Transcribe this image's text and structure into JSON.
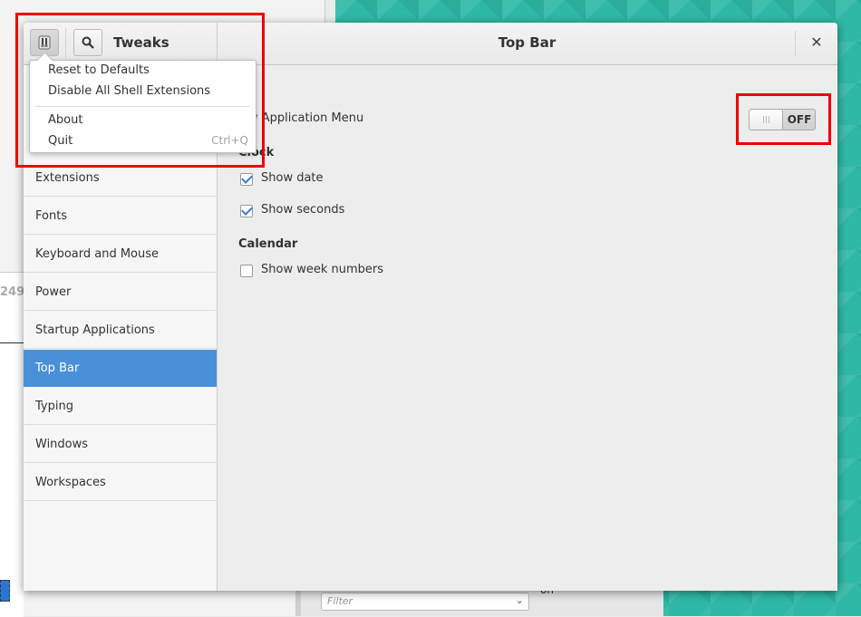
{
  "background": {
    "left_number_fragment": "249",
    "filter_placeholder": "Filter",
    "text_fragment": "on"
  },
  "headerbar": {
    "app_title": "Tweaks",
    "page_title": "Top Bar",
    "close_glyph": "✕"
  },
  "app_menu": {
    "items": [
      {
        "label": "Reset to Defaults"
      },
      {
        "label": "Disable All Shell Extensions"
      },
      {
        "label": "About"
      },
      {
        "label": "Quit",
        "accelerator": "Ctrl+Q"
      }
    ]
  },
  "sidebar": {
    "items": [
      {
        "label": "Extensions"
      },
      {
        "label": "Fonts"
      },
      {
        "label": "Keyboard and Mouse"
      },
      {
        "label": "Power"
      },
      {
        "label": "Startup Applications"
      },
      {
        "label": "Top Bar",
        "active": true
      },
      {
        "label": "Typing"
      },
      {
        "label": "Windows"
      },
      {
        "label": "Workspaces"
      }
    ]
  },
  "content": {
    "app_menu_row_label": "ow Application Menu",
    "app_menu_switch_text": "OFF",
    "clock_section": "Clock",
    "show_date_label": "Show date",
    "show_date_checked": true,
    "show_seconds_label": "Show seconds",
    "show_seconds_checked": true,
    "calendar_section": "Calendar",
    "show_week_numbers_label": "Show week numbers",
    "show_week_numbers_checked": false
  },
  "colors": {
    "accent": "#4a90d9",
    "annotation": "#e00000",
    "desktop_teal": "#2fb8a6"
  }
}
